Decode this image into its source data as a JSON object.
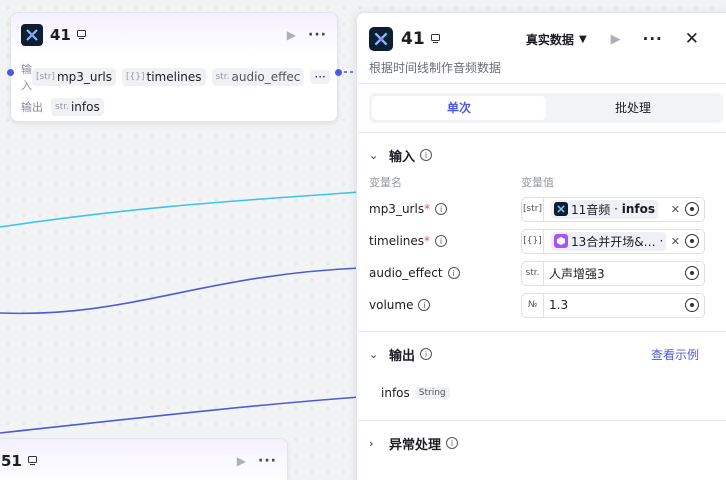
{
  "colors": {
    "accent": "#4e5bd9",
    "edge_cyan": "#3cc4f0",
    "edge_blue": "#4e5bd9",
    "required": "#f44b4b"
  },
  "node_top": {
    "title": "41",
    "input_label": "输入",
    "output_label": "输出",
    "inputs": [
      {
        "type": "[str]",
        "name": "mp3_urls"
      },
      {
        "type": "[{}]",
        "name": "timelines"
      },
      {
        "type": "str.",
        "name": "audio_effec"
      }
    ],
    "more_label": "···",
    "outputs": [
      {
        "type": "str.",
        "name": "infos"
      }
    ]
  },
  "node_bottom": {
    "title": "51"
  },
  "panel": {
    "title": "41",
    "data_mode": "真实数据",
    "description": "根据时间线制作音频数据",
    "tabs": [
      {
        "label": "单次",
        "active": true
      },
      {
        "label": "批处理",
        "active": false
      }
    ],
    "input_section": {
      "label": "输入",
      "col_name": "变量名",
      "col_value": "变量值",
      "rows": [
        {
          "name": "mp3_urls",
          "required": true,
          "type": "[str]",
          "ref_source": "11音频",
          "ref_sep": "·",
          "ref_field": "infos",
          "icon": "app-logo-icon"
        },
        {
          "name": "timelines",
          "required": true,
          "type": "[{}]",
          "ref_source": "13合并开场&…",
          "ref_sep": "·",
          "ref_field": "",
          "icon": "cube-icon"
        },
        {
          "name": "audio_effect",
          "required": false,
          "type": "str.",
          "value": "人声增强3"
        },
        {
          "name": "volume",
          "required": false,
          "type": "№",
          "value": "1.3"
        }
      ]
    },
    "output_section": {
      "label": "输出",
      "link": "查看示例",
      "rows": [
        {
          "name": "infos",
          "type": "String"
        }
      ]
    },
    "error_section": {
      "label": "异常处理"
    }
  }
}
